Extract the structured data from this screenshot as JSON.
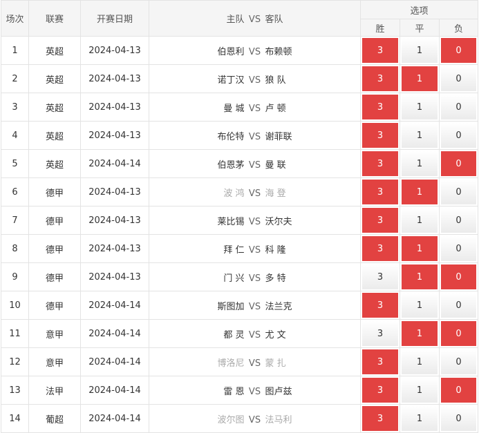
{
  "header": {
    "col_round": "场次",
    "col_league": "联赛",
    "col_date": "开赛日期",
    "col_home": "主队",
    "col_vs": "VS",
    "col_away": "客队",
    "col_options": "选项",
    "opt_win": "胜",
    "opt_draw": "平",
    "opt_lose": "负"
  },
  "vs_text": "VS",
  "colors": {
    "selected": "#e24241",
    "faded_team": "#aaaaaa"
  },
  "rows": [
    {
      "n": "1",
      "league": "英超",
      "date": "2024-04-13",
      "home": "伯恩利",
      "away": "布赖顿",
      "w": "3",
      "d": "1",
      "l": "0",
      "sel": [
        true,
        false,
        true
      ],
      "faded": false
    },
    {
      "n": "2",
      "league": "英超",
      "date": "2024-04-13",
      "home": "诺丁汉",
      "away": "狼 队",
      "w": "3",
      "d": "1",
      "l": "0",
      "sel": [
        true,
        true,
        false
      ],
      "faded": false
    },
    {
      "n": "3",
      "league": "英超",
      "date": "2024-04-13",
      "home": "曼 城",
      "away": "卢 顿",
      "w": "3",
      "d": "1",
      "l": "0",
      "sel": [
        true,
        false,
        false
      ],
      "faded": false
    },
    {
      "n": "4",
      "league": "英超",
      "date": "2024-04-13",
      "home": "布伦特",
      "away": "谢菲联",
      "w": "3",
      "d": "1",
      "l": "0",
      "sel": [
        true,
        false,
        false
      ],
      "faded": false
    },
    {
      "n": "5",
      "league": "英超",
      "date": "2024-04-14",
      "home": "伯恩茅",
      "away": "曼 联",
      "w": "3",
      "d": "1",
      "l": "0",
      "sel": [
        true,
        false,
        true
      ],
      "faded": false
    },
    {
      "n": "6",
      "league": "德甲",
      "date": "2024-04-13",
      "home": "波 鸿",
      "away": "海 登",
      "w": "3",
      "d": "1",
      "l": "0",
      "sel": [
        true,
        true,
        false
      ],
      "faded": true
    },
    {
      "n": "7",
      "league": "德甲",
      "date": "2024-04-13",
      "home": "莱比锡",
      "away": "沃尔夫",
      "w": "3",
      "d": "1",
      "l": "0",
      "sel": [
        true,
        false,
        false
      ],
      "faded": false
    },
    {
      "n": "8",
      "league": "德甲",
      "date": "2024-04-13",
      "home": "拜 仁",
      "away": "科 隆",
      "w": "3",
      "d": "1",
      "l": "0",
      "sel": [
        true,
        true,
        false
      ],
      "faded": false
    },
    {
      "n": "9",
      "league": "德甲",
      "date": "2024-04-13",
      "home": "门 兴",
      "away": "多 特",
      "w": "3",
      "d": "1",
      "l": "0",
      "sel": [
        false,
        true,
        true
      ],
      "faded": false
    },
    {
      "n": "10",
      "league": "德甲",
      "date": "2024-04-14",
      "home": "斯图加",
      "away": "法兰克",
      "w": "3",
      "d": "1",
      "l": "0",
      "sel": [
        true,
        false,
        false
      ],
      "faded": false
    },
    {
      "n": "11",
      "league": "意甲",
      "date": "2024-04-14",
      "home": "都 灵",
      "away": "尤 文",
      "w": "3",
      "d": "1",
      "l": "0",
      "sel": [
        false,
        true,
        true
      ],
      "faded": false
    },
    {
      "n": "12",
      "league": "意甲",
      "date": "2024-04-14",
      "home": "博洛尼",
      "away": "蒙 扎",
      "w": "3",
      "d": "1",
      "l": "0",
      "sel": [
        true,
        false,
        false
      ],
      "faded": true
    },
    {
      "n": "13",
      "league": "法甲",
      "date": "2024-04-14",
      "home": "雷 恩",
      "away": "图卢兹",
      "w": "3",
      "d": "1",
      "l": "0",
      "sel": [
        true,
        false,
        true
      ],
      "faded": false
    },
    {
      "n": "14",
      "league": "葡超",
      "date": "2024-04-14",
      "home": "波尔图",
      "away": "法马利",
      "w": "3",
      "d": "1",
      "l": "0",
      "sel": [
        true,
        false,
        false
      ],
      "faded": true
    }
  ]
}
